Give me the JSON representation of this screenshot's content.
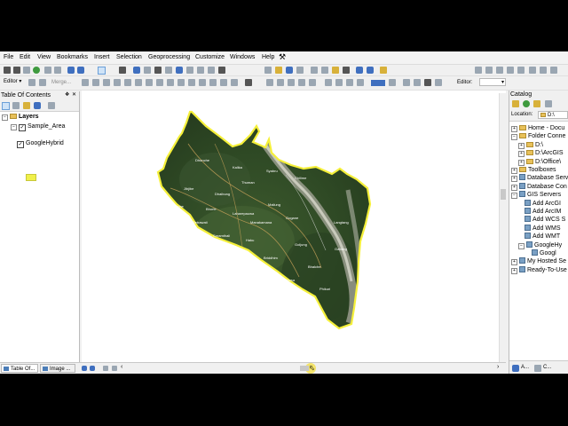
{
  "menubar": {
    "items": [
      "File",
      "Edit",
      "View",
      "Bookmarks",
      "Insert",
      "Selection",
      "Geoprocessing",
      "Customize",
      "Windows",
      "Help"
    ]
  },
  "toolbar": {
    "editor_label": "Editor ▾",
    "merge_label": "Merge...",
    "editor2_label": "Editor:",
    "colors": {
      "accent": "#3f6fbf",
      "toolbar_bg": "#f0f0f0"
    }
  },
  "toc": {
    "title": "Table Of Contents",
    "close_glyph": "✕",
    "pin_glyph": "❖",
    "layers_label": "Layers",
    "layers": [
      {
        "name": "Sample_Area",
        "checked": true,
        "symbol_color": "#f0f04a"
      },
      {
        "name": "GoogleHybrid",
        "checked": true
      }
    ],
    "tabs": [
      "Table Of...",
      "Image ..."
    ]
  },
  "catalog": {
    "title": "Catalog",
    "location_label": "Location:",
    "location_value": "D:\\",
    "items": [
      {
        "label": "Home - Docu",
        "indent": 0,
        "icon": "home",
        "expander": "+"
      },
      {
        "label": "Folder Conne",
        "indent": 0,
        "icon": "folder",
        "expander": "-"
      },
      {
        "label": "D:\\",
        "indent": 1,
        "icon": "folder",
        "expander": "+"
      },
      {
        "label": "D:\\ArcGIS",
        "indent": 1,
        "icon": "folder",
        "expander": "+"
      },
      {
        "label": "D:\\Office\\",
        "indent": 1,
        "icon": "folder",
        "expander": "+"
      },
      {
        "label": "Toolboxes",
        "indent": 0,
        "icon": "toolbox",
        "expander": "+"
      },
      {
        "label": "Database Serv",
        "indent": 0,
        "icon": "db",
        "expander": "+"
      },
      {
        "label": "Database Con",
        "indent": 0,
        "icon": "db",
        "expander": "+"
      },
      {
        "label": "GIS Servers",
        "indent": 0,
        "icon": "server",
        "expander": "-"
      },
      {
        "label": "Add ArcGI",
        "indent": 1,
        "icon": "server",
        "expander": ""
      },
      {
        "label": "Add ArcIM",
        "indent": 1,
        "icon": "server",
        "expander": ""
      },
      {
        "label": "Add WCS S",
        "indent": 1,
        "icon": "server",
        "expander": ""
      },
      {
        "label": "Add WMS",
        "indent": 1,
        "icon": "server",
        "expander": ""
      },
      {
        "label": "Add WMT",
        "indent": 1,
        "icon": "server",
        "expander": ""
      },
      {
        "label": "GoogleHy",
        "indent": 1,
        "icon": "server",
        "expander": "-"
      },
      {
        "label": "Googl",
        "indent": 2,
        "icon": "globe",
        "expander": ""
      },
      {
        "label": "My Hosted Se",
        "indent": 0,
        "icon": "server",
        "expander": "+"
      },
      {
        "label": "Ready-To-Use",
        "indent": 0,
        "icon": "server",
        "expander": "+"
      }
    ],
    "bottom_icons": [
      "A...",
      "C..."
    ]
  },
  "map": {
    "place_labels": [
      "Dhunche",
      "Kalika",
      "Syabru",
      "Chilime",
      "Thuman",
      "Jibjibe",
      "Dhaibung",
      "Ramche",
      "Bhorle",
      "Laharepauwa",
      "Betrawati",
      "Manakamana",
      "Gogane",
      "Saramthali",
      "Haku",
      "Langtang",
      "Goljung",
      "Briddhim",
      "Bhalche",
      "Yarsa",
      "Phikuri",
      "Haku Besi",
      "Gatlang",
      "Mailung"
    ]
  }
}
